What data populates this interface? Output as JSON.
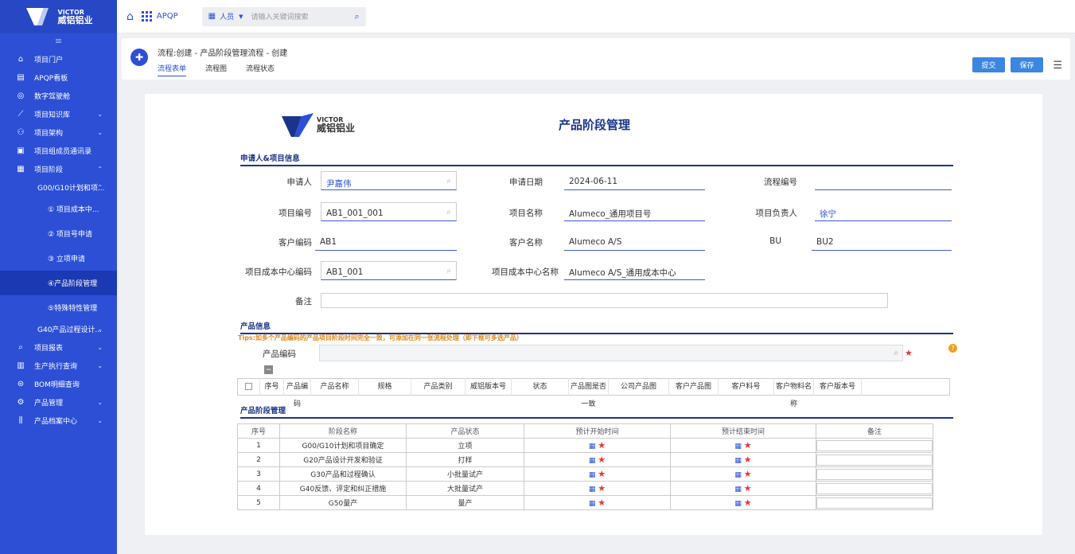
{
  "sidebar": {
    "items": [
      {
        "label": "项目门户",
        "icon": "home-outline-icon",
        "chev": ""
      },
      {
        "label": "APQP看板",
        "icon": "board-icon",
        "chev": ""
      },
      {
        "label": "数字驾驶舱",
        "icon": "dashboard-icon",
        "chev": ""
      },
      {
        "label": "项目知识库",
        "icon": "chart-icon",
        "chev": "⌄"
      },
      {
        "label": "项目架构",
        "icon": "people-icon",
        "chev": "⌄"
      },
      {
        "label": "项目组成员通讯录",
        "icon": "contacts-icon",
        "chev": ""
      },
      {
        "label": "项目阶段",
        "icon": "stage-icon",
        "chev": "⌃"
      },
      {
        "label": "G00/G10计划和项...",
        "icon": "",
        "chev": "⌃"
      },
      {
        "label": "① 项目成本中...",
        "icon": "",
        "chev": ""
      },
      {
        "label": "② 项目号申请",
        "icon": "",
        "chev": ""
      },
      {
        "label": "③ 立项申请",
        "icon": "",
        "chev": ""
      },
      {
        "label": "④产品阶段管理",
        "icon": "",
        "chev": ""
      },
      {
        "label": "⑤特殊特性管理",
        "icon": "",
        "chev": ""
      },
      {
        "label": "G40产品过程设计...",
        "icon": "",
        "chev": "⌄"
      },
      {
        "label": "项目报表",
        "icon": "search-icon",
        "chev": "⌄"
      },
      {
        "label": "生产执行查询",
        "icon": "table-icon",
        "chev": "⌄"
      },
      {
        "label": "BOM明细查询",
        "icon": "bom-icon",
        "chev": ""
      },
      {
        "label": "产品管理",
        "icon": "gear-icon",
        "chev": "⌄"
      },
      {
        "label": "产品档案中心",
        "icon": "archive-icon",
        "chev": "⌄"
      }
    ]
  },
  "logo": {
    "brand": "VICTOR",
    "cn": "威铝铝业"
  },
  "topbar": {
    "app": "APQP",
    "person": "人员",
    "search_placeholder": "请输入关键词搜索"
  },
  "flow": {
    "title": "流程:创建 - 产品阶段管理流程 - 创建",
    "tabs": [
      "流程表单",
      "流程图",
      "流程状态"
    ],
    "submit": "提交",
    "save": "保存"
  },
  "form": {
    "title": "产品阶段管理",
    "sec1": "申请人&项目信息",
    "fields": {
      "applicant_l": "申请人",
      "applicant": "尹嘉伟",
      "date_l": "申请日期",
      "date": "2024-06-11",
      "flowno_l": "流程编号",
      "flowno": "",
      "projno_l": "项目编号",
      "projno": "AB1_001_001",
      "projname_l": "项目名称",
      "projname": "Alumeco_通用项目号",
      "owner_l": "项目负责人",
      "owner": "徐宁",
      "custcode_l": "客户编码",
      "custcode": "AB1",
      "custname_l": "客户名称",
      "custname": "Alumeco A/S",
      "bu_l": "BU",
      "bu": "BU2",
      "cc_l": "项目成本中心编码",
      "cc": "AB1_001",
      "ccname_l": "项目成本中心名称",
      "ccname": "Alumeco A/S_通用成本中心",
      "remark_l": "备注"
    },
    "sec2": "产品信息",
    "tips": "Tips:如多个产品编码的产品项目阶段时间完全一致，可添加在同一张流程处理（即下框可多选产品）",
    "prodcode_l": "产品编码",
    "prod_cols": [
      "序号",
      "产品编码",
      "产品名称",
      "规格",
      "产品类别",
      "威铝版本号",
      "状态",
      "产品图是否一致",
      "公司产品图",
      "客户产品图",
      "客户料号",
      "客户物料名称",
      "客户版本号"
    ],
    "sec3": "产品阶段管理",
    "stage_cols": [
      "序号",
      "阶段名称",
      "产品状态",
      "预计开始时间",
      "预计结束时间",
      "备注"
    ],
    "stages": [
      {
        "no": "1",
        "name": "G00/G10计划和项目确定",
        "status": "立项"
      },
      {
        "no": "2",
        "name": "G20产品设计开发和验证",
        "status": "打样"
      },
      {
        "no": "3",
        "name": "G30产品和过程确认",
        "status": "小批量试产"
      },
      {
        "no": "4",
        "name": "G40反馈、评定和纠正措施",
        "status": "大批量试产"
      },
      {
        "no": "5",
        "name": "G50量产",
        "status": "量产"
      }
    ]
  },
  "colors": {
    "primary": "#2c4fd6",
    "dark": "#1a3489",
    "tip": "#e08a1c"
  }
}
